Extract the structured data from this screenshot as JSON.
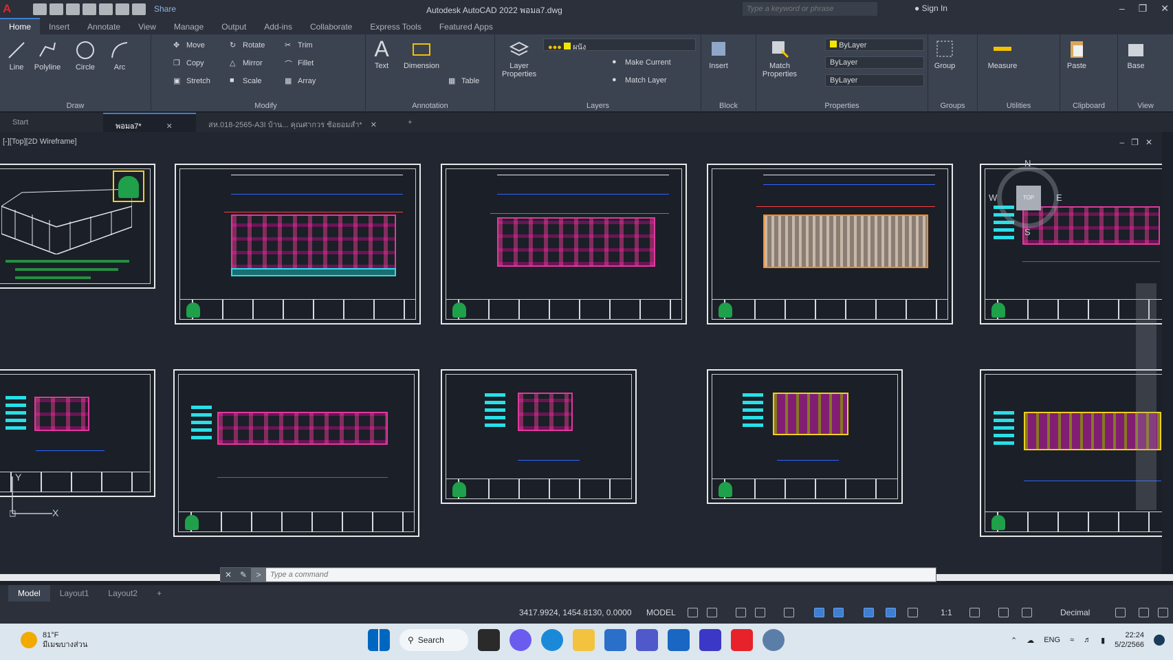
{
  "titlebar": {
    "app_title": "Autodesk AutoCAD 2022  พอมa7.dwg",
    "share_label": "Share",
    "search_placeholder": "Type a keyword or phrase",
    "sign_in": "Sign In"
  },
  "ribbon_tabs": [
    "Home",
    "Insert",
    "Annotate",
    "View",
    "Manage",
    "Output",
    "Add-ins",
    "Collaborate",
    "Express Tools",
    "Featured Apps"
  ],
  "active_tab": "Home",
  "ribbon": {
    "draw": {
      "title": "Draw",
      "line": "Line",
      "polyline": "Polyline",
      "circle": "Circle",
      "arc": "Arc"
    },
    "modify": {
      "title": "Modify",
      "move": "Move",
      "rotate": "Rotate",
      "trim": "Trim",
      "copy": "Copy",
      "mirror": "Mirror",
      "fillet": "Fillet",
      "stretch": "Stretch",
      "scale": "Scale",
      "array": "Array"
    },
    "annotation": {
      "title": "Annotation",
      "text": "Text",
      "dimension": "Dimension",
      "table": "Table"
    },
    "layers": {
      "title": "Layers",
      "layer_properties": "Layer Properties",
      "current_layer": "ผนัง",
      "make_current": "Make Current",
      "match_layer": "Match Layer"
    },
    "block": {
      "title": "Block",
      "insert": "Insert"
    },
    "properties": {
      "title": "Properties",
      "match_properties": "Match Properties",
      "color": "ByLayer",
      "linetype": "ByLayer",
      "lineweight": "ByLayer"
    },
    "groups": {
      "title": "Groups",
      "group": "Group"
    },
    "utilities": {
      "title": "Utilities",
      "measure": "Measure"
    },
    "clipboard": {
      "title": "Clipboard",
      "paste": "Paste"
    },
    "view": {
      "title": "View",
      "base": "Base"
    }
  },
  "file_tabs": [
    {
      "label": "Start"
    },
    {
      "label": "พอมa7*"
    },
    {
      "label": "สห.018-2565-A3I บ้าน... คุณศากวร ช้อยอมสำ*"
    }
  ],
  "viewport": {
    "label": "[-][Top][2D Wireframe]",
    "navcube": {
      "n": "N",
      "s": "S",
      "e": "E",
      "w": "W",
      "face": "TOP"
    },
    "ucs_x": "X",
    "ucs_y": "Y"
  },
  "command": {
    "placeholder": "Type a command"
  },
  "layout_tabs": [
    "Model",
    "Layout1",
    "Layout2"
  ],
  "status": {
    "coords": "3417.9924, 1454.8130, 0.0000",
    "model": "MODEL",
    "scale": "1:1",
    "units": "Decimal"
  },
  "taskbar": {
    "temp": "81°F",
    "weather": "มีเมฆบางส่วน",
    "search": "Search",
    "lang": "ENG",
    "time": "22:24",
    "date": "5/2/2566"
  },
  "colors": {
    "accent": "#3f7fd1",
    "autocad_red": "#e8222a"
  }
}
